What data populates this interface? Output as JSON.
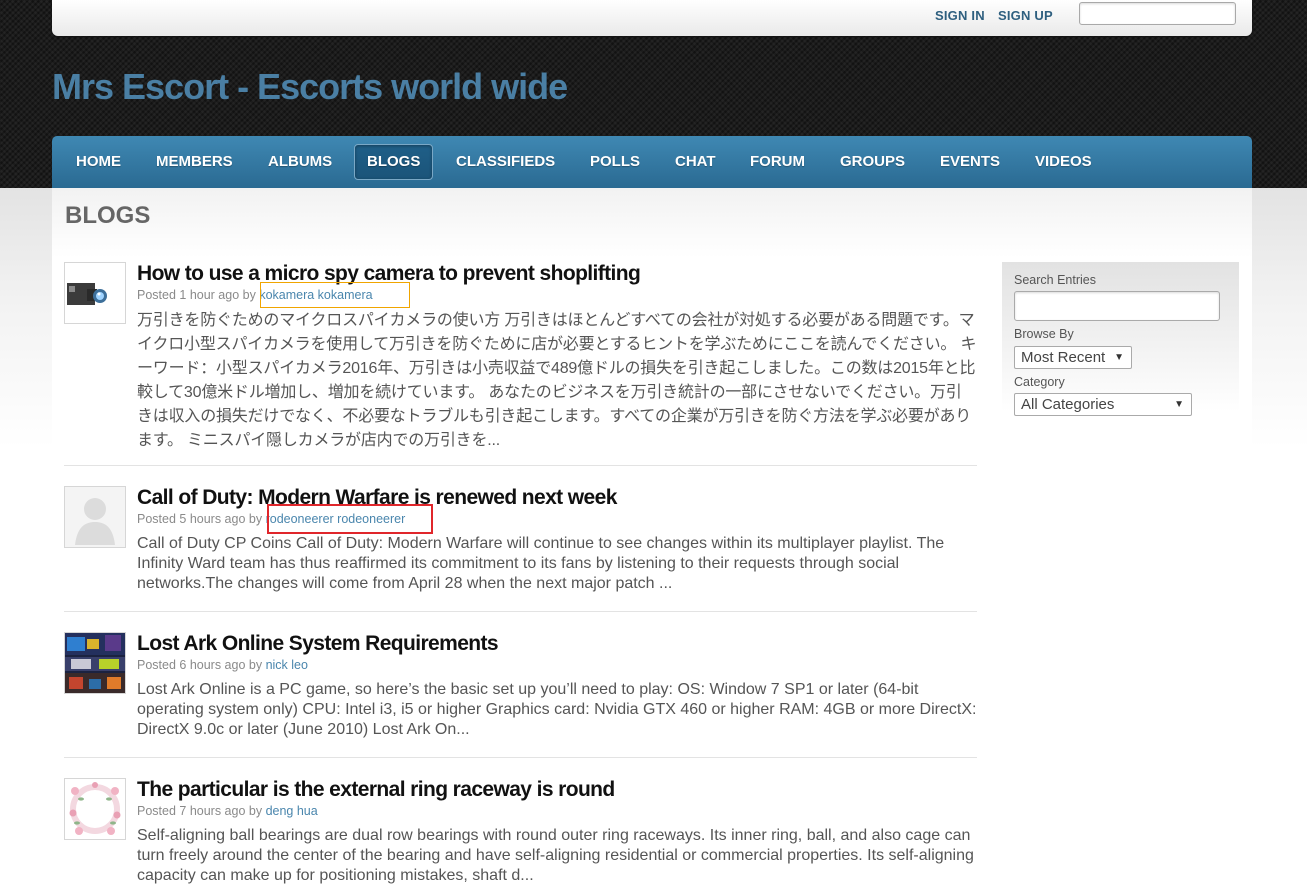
{
  "header": {
    "sign_in": "SIGN IN",
    "sign_up": "SIGN UP",
    "search_value": "",
    "site_title": "Mrs Escort - Escorts world wide"
  },
  "nav": {
    "items": [
      {
        "label": "HOME",
        "active": false
      },
      {
        "label": "MEMBERS",
        "active": false
      },
      {
        "label": "ALBUMS",
        "active": false
      },
      {
        "label": "BLOGS",
        "active": true
      },
      {
        "label": "CLASSIFIEDS",
        "active": false
      },
      {
        "label": "POLLS",
        "active": false
      },
      {
        "label": "CHAT",
        "active": false
      },
      {
        "label": "FORUM",
        "active": false
      },
      {
        "label": "GROUPS",
        "active": false
      },
      {
        "label": "EVENTS",
        "active": false
      },
      {
        "label": "VIDEOS",
        "active": false
      }
    ]
  },
  "page": {
    "heading": "BLOGS"
  },
  "posts": [
    {
      "title": "How to use a micro spy camera to prevent shoplifting",
      "posted": "Posted 1 hour ago by",
      "author": "kokamera kokamera",
      "excerpt": "万引きを防ぐためのマイクロスパイカメラの使い方 万引きはほとんどすべての会社が対処する必要がある問題です。マイクロ小型スパイカメラを使用して万引きを防ぐために店が必要とするヒントを学ぶためにここを読んでください。 キーワード：小型スパイカメラ2016年、万引きは小売収益で489億ドルの損失を引き起こしました。この数は2015年と比較して30億米ドル増加し、増加を続けています。 あなたのビジネスを万引き統計の一部にさせないでください。万引きは収入の損失だけでなく、不必要なトラブルも引き起こします。すべての企業が万引きを防ぐ方法を学ぶ必要があります。 ミニスパイ隠しカメラが店内での万引きを...",
      "thumb": "camera-thumbnail",
      "highlight_color": "#f0a500"
    },
    {
      "title": "Call of Duty: Modern Warfare is renewed next week",
      "posted": "Posted 5 hours ago by",
      "author": "rodeoneerer rodeoneerer",
      "excerpt": "Call of Duty CP Coins Call of Duty: Modern Warfare will continue to see changes within its multiplayer playlist. The Infinity Ward team has thus reaffirmed its commitment to its fans by listening to their requests through social networks.The changes will come from April 28 when the next major patch ...",
      "thumb": "default-avatar-thumbnail",
      "highlight_color": "#e0262b"
    },
    {
      "title": "Lost Ark Online System Requirements",
      "posted": "Posted 6 hours ago by",
      "author": "nick leo",
      "excerpt": "Lost Ark Online is a PC game, so here’s the basic set up you’ll need to play: OS: Window 7 SP1 or later (64-bit operating system only) CPU: Intel i3, i5 or higher Graphics card: Nvidia GTX 460 or higher RAM: 4GB or more DirectX: DirectX 9.0c or later (June 2010)   Lost Ark On...",
      "thumb": "game-art-thumbnail"
    },
    {
      "title": "The particular is the external ring raceway is round",
      "posted": "Posted 7 hours ago by",
      "author": "deng hua",
      "excerpt": "Self-aligning ball bearings are dual row bearings with round outer ring raceways. Its inner ring, ball, and also cage can turn freely around the center of the bearing and have self-aligning residential or commercial properties. Its self-aligning capacity can make up for positioning mistakes, shaft d...",
      "thumb": "floral-wreath-thumbnail"
    }
  ],
  "sidebar": {
    "search_label": "Search Entries",
    "search_value": "",
    "browse_label": "Browse By",
    "browse_value": "Most Recent",
    "category_label": "Category",
    "category_value": "All Categories",
    "caret_icon": "▼"
  },
  "colors": {
    "nav_blue": "#2f76a0",
    "link_blue": "#4a86ad",
    "title_blue": "#4a7fa4"
  }
}
